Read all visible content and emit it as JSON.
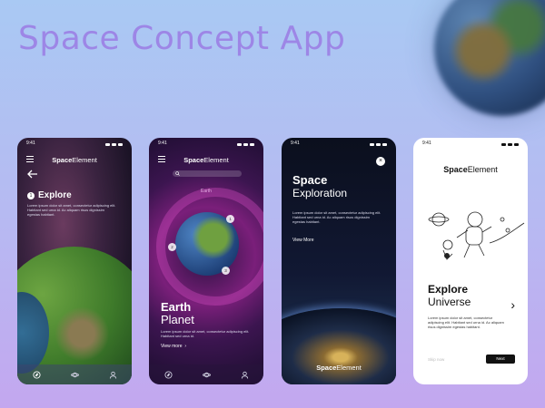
{
  "page": {
    "title": "Space Concept App"
  },
  "brand": {
    "bold": "Space",
    "light": "Element"
  },
  "status_time": "9:41",
  "screen1": {
    "heading": "Explore",
    "step": "1",
    "body": "Lorem ipsum dolor sit amet, consectetur adipiscing elit. Habitant sed urna id. Ac aliquam risus dignissim egestas habitant."
  },
  "screen2": {
    "search_placeholder": "Search",
    "label": "Earth",
    "markers": [
      "1",
      "2",
      "3"
    ],
    "heading_bold": "Earth",
    "heading_light": "Planet",
    "body": "Lorem ipsum dolor sit amet, consectetur adipiscing elit. Habitant sed urna id.",
    "link": "View more",
    "link_arrow": "›"
  },
  "screen3": {
    "close_glyph": "×",
    "heading_bold": "Space",
    "heading_light": "Exploration",
    "body": "Lorem ipsum dolor sit amet, consectetur adipiscing elit. Habitant sed urna id. Ac aliquam risus dignissim egestas habitant.",
    "link": "View More"
  },
  "screen4": {
    "heading_bold": "Explore",
    "heading_light": "Universe",
    "arrow_glyph": "›",
    "body": "Lorem ipsum dolor sit amet, consectetur adipiscing elit. Habitant sed urna id. Ac aliquam risus dignissim egestas habitant.",
    "skip": "Skip now",
    "next": "Next"
  },
  "icons": {
    "menu": "menu-icon",
    "back": "back-arrow-icon",
    "search": "search-icon",
    "compass": "compass-icon",
    "planet": "planet-icon",
    "user": "user-icon",
    "close": "close-icon",
    "chevron": "chevron-right-icon"
  },
  "colors": {
    "title": "#9d86e6",
    "background_top": "#a9c9f3",
    "background_bottom": "#c3a7ef"
  }
}
